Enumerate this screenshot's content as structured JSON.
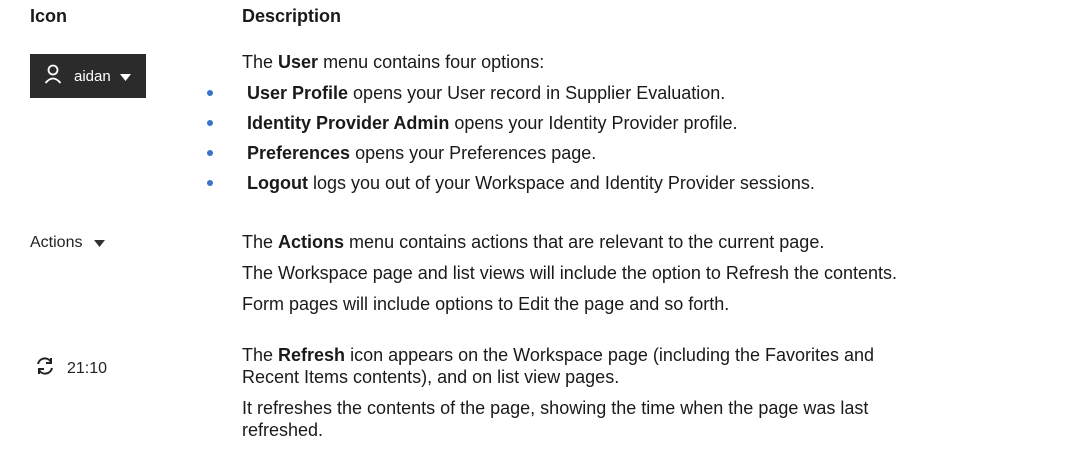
{
  "headers": {
    "icon": "Icon",
    "description": "Description"
  },
  "user_menu": {
    "icon": "person-icon",
    "username": "aidan",
    "intro_pre": "The ",
    "intro_bold": "User",
    "intro_post": " menu contains four options:",
    "items": [
      {
        "bold": "User Profile",
        "text": " opens your User record in Supplier Evaluation."
      },
      {
        "bold": "Identity Provider Admin",
        "text": " opens your Identity Provider profile."
      },
      {
        "bold": "Preferences",
        "text": " opens your Preferences page."
      },
      {
        "bold": "Logout",
        "text": " logs you out of your Workspace and Identity Provider sessions."
      }
    ]
  },
  "actions_menu": {
    "label": "Actions",
    "line1_pre": "The ",
    "line1_bold": "Actions",
    "line1_post": " menu contains actions that are relevant to the current page.",
    "line2": "The Workspace page and list views will include the option to Refresh the contents.",
    "line3": "Form pages will include options to Edit the page and so forth."
  },
  "refresh": {
    "icon": "refresh-icon",
    "time": "21:10",
    "line1_pre": "The ",
    "line1_bold": "Refresh",
    "line1_post": " icon appears on the Workspace page (including the Favorites and",
    "line2": "Recent Items contents), and on list view pages.",
    "line3": "It refreshes the contents of the page, showing the time when the page was last",
    "line4": "refreshed."
  },
  "colors": {
    "dark_bar": "#2b2b2b",
    "bullet": "#3b73c6"
  }
}
